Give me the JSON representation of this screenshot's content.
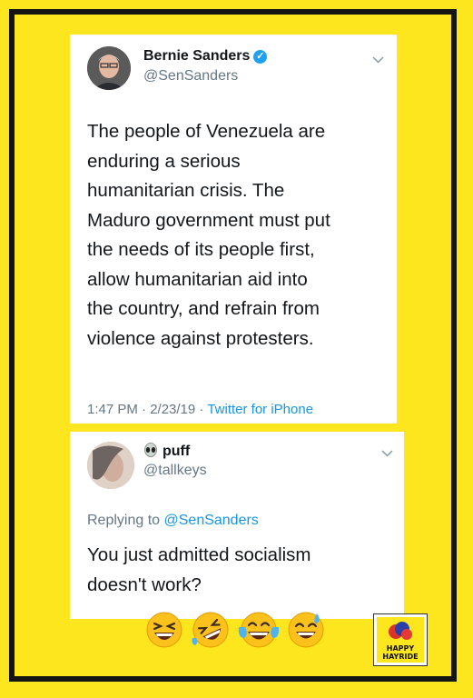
{
  "tweet": {
    "name": "Bernie Sanders",
    "handle": "@SenSanders",
    "verified_icon": "verified-check-icon",
    "lines": [
      "The people of Venezuela are",
      "enduring a serious",
      "humanitarian crisis. The",
      "Maduro government must put",
      "the needs of its people first,",
      "allow humanitarian aid into",
      "the country, and refrain from",
      "violence against protesters."
    ],
    "time_date": "1:47 PM · 2/23/19 · ",
    "source": "Twitter for iPhone"
  },
  "reply": {
    "name": "puff",
    "handle": "@tallkeys",
    "name_prefix_icon": "alien-icon",
    "replying_prefix": "Replying to ",
    "replying_mention": "@SenSanders",
    "lines": [
      "You just admitted socialism",
      "doesn't work?"
    ]
  },
  "emojis": [
    "squinting-laugh-icon",
    "rolling-laugh-icon",
    "tears-of-joy-icon",
    "sweat-smile-icon"
  ],
  "logo": {
    "line1": "HAPPY",
    "line2": "HAYRIDE"
  },
  "colors": {
    "background": "#fde61e",
    "frame": "#141414",
    "link": "#1b95e0",
    "verified": "#1da1f2"
  }
}
